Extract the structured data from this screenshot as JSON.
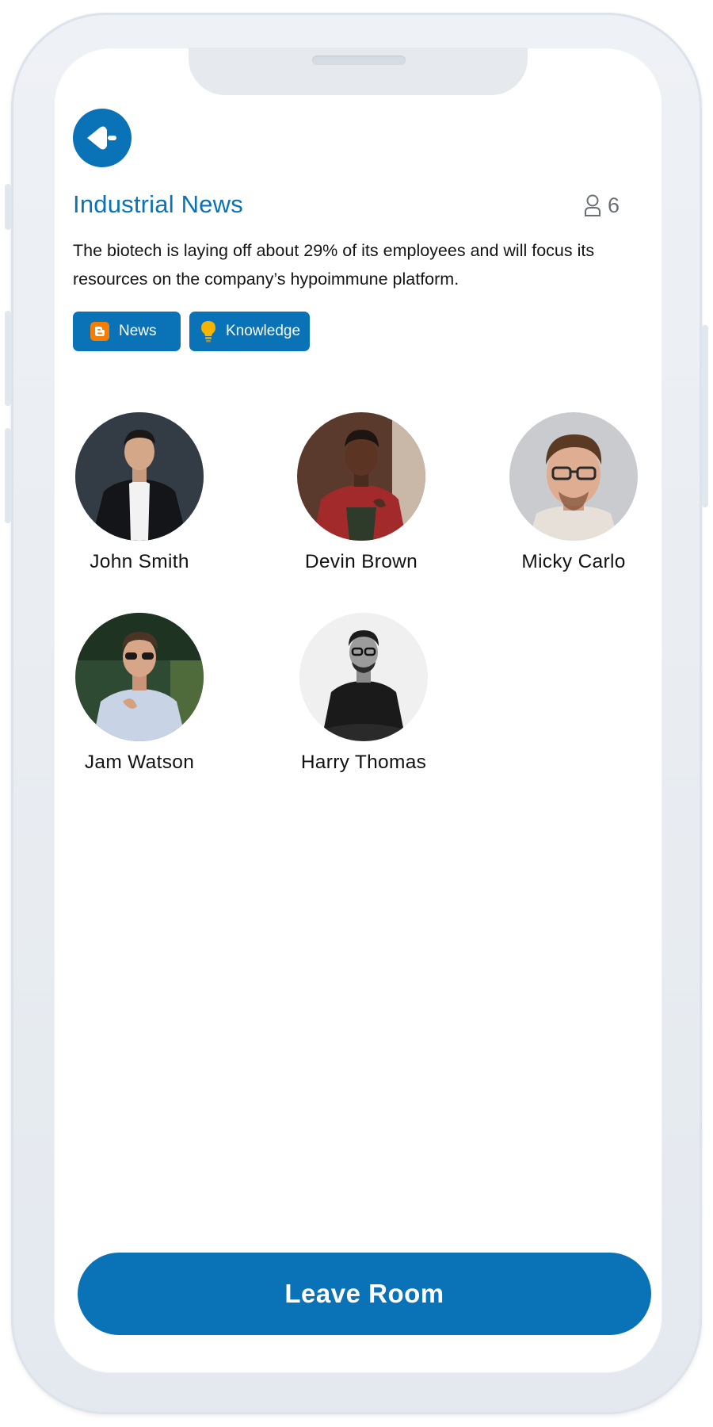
{
  "header": {
    "title": "Industrial News",
    "listener_count": "6"
  },
  "description": "The biotech is laying off about 29% of its employees and will focus its resources on the company’s hypoimmune platform.",
  "tags": [
    {
      "label": "News",
      "icon": "blogger-icon"
    },
    {
      "label": "Knowledge",
      "icon": "lightbulb-icon"
    }
  ],
  "participants": [
    {
      "name": "John Smith"
    },
    {
      "name": "Devin Brown"
    },
    {
      "name": "Micky Carlo"
    },
    {
      "name": "Jam Watson"
    },
    {
      "name": "Harry Thomas"
    }
  ],
  "footer": {
    "leave_label": "Leave Room"
  },
  "colors": {
    "accent": "#0a72b6",
    "blogger_orange": "#f57d00",
    "bulb_yellow": "#f5b400"
  }
}
